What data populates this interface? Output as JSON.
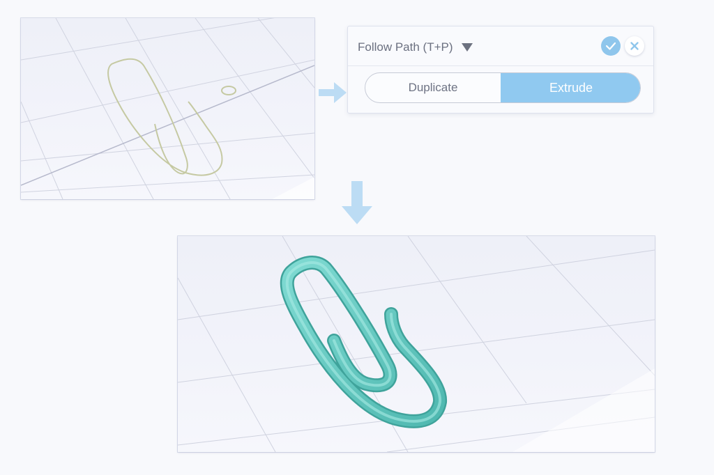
{
  "panel": {
    "title": "Follow Path (T+P)",
    "confirm_icon": "check-icon",
    "cancel_icon": "close-icon",
    "options": [
      {
        "label": "Duplicate",
        "selected": false
      },
      {
        "label": "Extrude",
        "selected": true
      }
    ]
  },
  "viewports": {
    "top": {
      "content": "paperclip-path-curve",
      "curve_color": "#c5c9a2"
    },
    "bottom": {
      "content": "extruded-paperclip-model",
      "model_color": "#6fd0c8"
    }
  },
  "arrows": {
    "color": "#bcdcf4",
    "icons": [
      "arrow-right-icon",
      "arrow-down-icon"
    ]
  },
  "colors": {
    "accent": "#90c9f0",
    "background": "#f8f9fc",
    "grid": "#c8cbd9"
  }
}
